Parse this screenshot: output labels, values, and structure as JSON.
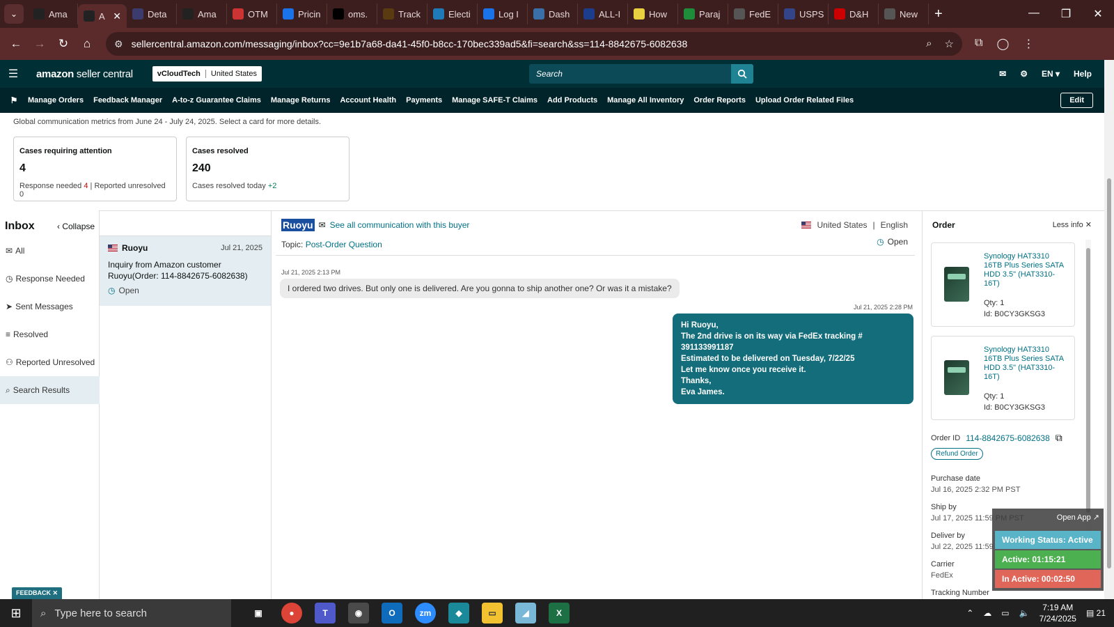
{
  "browser": {
    "tabs": [
      {
        "label": "Ama",
        "color": "#222"
      },
      {
        "label": "A",
        "color": "#222",
        "active": true
      },
      {
        "label": "Deta",
        "color": "#3c3b6e"
      },
      {
        "label": "Ama",
        "color": "#222"
      },
      {
        "label": "OTM",
        "color": "#c33"
      },
      {
        "label": "Pricin",
        "color": "#1a73e8"
      },
      {
        "label": "oms.",
        "color": "#000"
      },
      {
        "label": "Track",
        "color": "#5a3a10"
      },
      {
        "label": "Electi",
        "color": "#1e7bb8"
      },
      {
        "label": "Log I",
        "color": "#1a73e8"
      },
      {
        "label": "Dash",
        "color": "#3a6fa8"
      },
      {
        "label": "ALL-I",
        "color": "#1c3c8c"
      },
      {
        "label": "How",
        "color": "#e8d040"
      },
      {
        "label": "Paraj",
        "color": "#1e8c3a"
      },
      {
        "label": "FedE",
        "color": "#555"
      },
      {
        "label": "USPS",
        "color": "#334488"
      },
      {
        "label": "D&H",
        "color": "#c00"
      },
      {
        "label": "New",
        "color": "#555"
      }
    ],
    "url": "sellercentral.amazon.com/messaging/inbox?cc=9e1b7a68-da41-45f0-b8cc-170bec339ad5&fi=search&ss=114-8842675-6082638"
  },
  "header": {
    "logo_main": "amazon",
    "logo_sub": " seller central",
    "account_name": "vCloudTech",
    "account_region": "United States",
    "search_placeholder": "Search",
    "lang": "EN ▾",
    "help": "Help"
  },
  "nav": {
    "items": [
      "Manage Orders",
      "Feedback Manager",
      "A-to-z Guarantee Claims",
      "Manage Returns",
      "Account Health",
      "Payments",
      "Manage SAFE-T Claims",
      "Add Products",
      "Manage All Inventory",
      "Order Reports",
      "Upload Order Related Files"
    ],
    "edit": "Edit"
  },
  "metrics": {
    "note": "Global communication metrics from June 24 - July 24, 2025. Select a card for more details.",
    "attention": {
      "title": "Cases requiring attention",
      "value": "4",
      "response_label": "Response needed",
      "response_value": "4",
      "unresolved_label": "Reported unresolved",
      "unresolved_value": "0"
    },
    "resolved": {
      "title": "Cases resolved",
      "value": "240",
      "today_label": "Cases resolved today",
      "today_value": "+2"
    }
  },
  "inbox": {
    "title": "Inbox",
    "collapse": "Collapse",
    "folders": [
      "All",
      "Response Needed",
      "Sent Messages",
      "Resolved",
      "Reported Unresolved",
      "Search Results"
    ]
  },
  "conversation": {
    "buyer": "Ruoyu",
    "date": "Jul 21, 2025",
    "body": "Inquiry from Amazon customer Ruoyu(Order: 114-8842675-6082638)",
    "status": "Open"
  },
  "thread": {
    "buyer": "Ruoyu",
    "see_all": "See all communication with this buyer",
    "country": "United States",
    "language": "English",
    "topic_label": "Topic:",
    "topic": "Post-Order Question",
    "status": "Open",
    "msg1_time": "Jul 21, 2025 2:13 PM",
    "msg1": "I ordered two drives. But only one is delivered. Are you gonna to ship another one? Or was it a mistake?",
    "msg2_time": "Jul 21, 2025 2:28 PM",
    "msg2_lines": [
      "Hi Ruoyu,",
      "The 2nd drive is on its way via FedEx tracking # 391133991187",
      "Estimated to be delivered on Tuesday, 7/22/25",
      "Let me know once you receive it.",
      "Thanks,",
      "Eva James."
    ]
  },
  "order": {
    "title": "Order",
    "less_info": "Less info",
    "products": [
      {
        "title": "Synology HAT3310 16TB Plus Series SATA HDD 3.5\" (HAT3310-16T)",
        "qty": "Qty: 1",
        "id": "Id: B0CY3GKSG3"
      },
      {
        "title": "Synology HAT3310 16TB Plus Series SATA HDD 3.5\" (HAT3310-16T)",
        "qty": "Qty: 1",
        "id": "Id: B0CY3GKSG3"
      }
    ],
    "order_id_label": "Order ID",
    "order_id": "114-8842675-6082638",
    "refund": "Refund Order",
    "purchase_label": "Purchase date",
    "purchase": "Jul 16, 2025 2:32 PM PST",
    "ship_label": "Ship by",
    "ship": "Jul 17, 2025 11:59 PM PST",
    "deliver_label": "Deliver by",
    "deliver": "Jul 22, 2025 11:59 PM PST",
    "carrier_label": "Carrier",
    "carrier": "FedEx",
    "tracking_label": "Tracking Number"
  },
  "widget": {
    "open_app": "Open App ↗",
    "working": "Working Status: Active",
    "active": "Active: 01:15:21",
    "inactive": "In Active: 00:02:50",
    "colors": {
      "working": "#5ab4c8",
      "active": "#4caf50",
      "inactive": "#e0665a"
    }
  },
  "feedback": "FEEDBACK ✕",
  "taskbar": {
    "search_placeholder": "Type here to search",
    "time": "7:19 AM",
    "date": "7/24/2025",
    "notif": "21"
  }
}
